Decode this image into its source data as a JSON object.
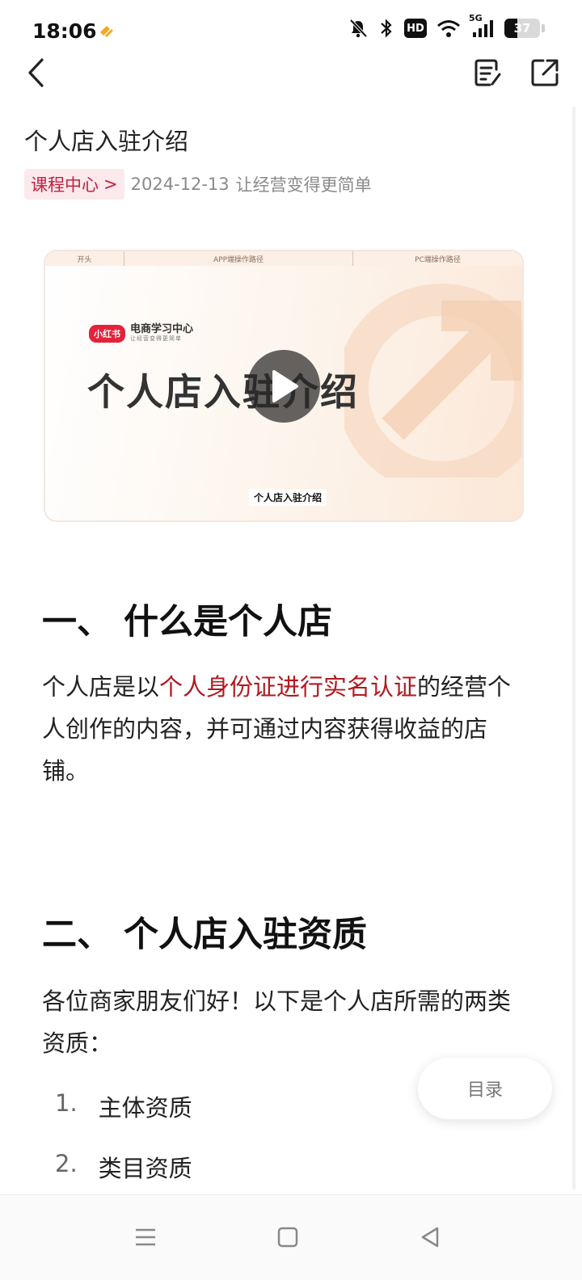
{
  "status_bar": {
    "time": "18:06",
    "battery": "37",
    "battery_level_percent": 37,
    "network": "5G",
    "hd": "HD",
    "icons": [
      "app-notification-icon",
      "mute-icon",
      "bluetooth-icon",
      "hd-icon",
      "wifi-icon",
      "signal-icon",
      "battery-icon"
    ]
  },
  "nav": {
    "icons": [
      "back-arrow-icon",
      "notes-icon",
      "share-icon"
    ]
  },
  "article": {
    "title": "个人店入驻介绍",
    "tag": "课程中心",
    "tag_arrow": ">",
    "date": "2024-12-13",
    "slogan": "让经营变得更简单"
  },
  "video": {
    "tab1": "开头",
    "tab2": "APP端操作路径",
    "tab3": "PC端操作路径",
    "brand_logo": "小红书",
    "brand_name": "电商学习中心",
    "brand_sub": "让经营变得更简单",
    "big_title": "个人店入驻介绍",
    "caption": "个人店入驻介绍",
    "accent_color": "#e4223b"
  },
  "section1": {
    "title": "一、 什么是个人店",
    "text_before": "个人店是以",
    "text_highlight": "个人身份证进行实名认证",
    "text_after": "的经营个人创作的内容，并可通过内容获得收益的店铺。"
  },
  "section2": {
    "title": "二、 个人店入驻资质",
    "intro": "各位商家朋友们好！以下是个人店所需的两类资质：",
    "items": [
      {
        "num": "1.",
        "label": "主体资质"
      },
      {
        "num": "2.",
        "label": "类目资质"
      }
    ]
  },
  "toc": {
    "label": "目录"
  },
  "colors": {
    "tag_bg": "#fbe9ec",
    "tag_text": "#c3223f",
    "highlight": "#b3191f"
  }
}
